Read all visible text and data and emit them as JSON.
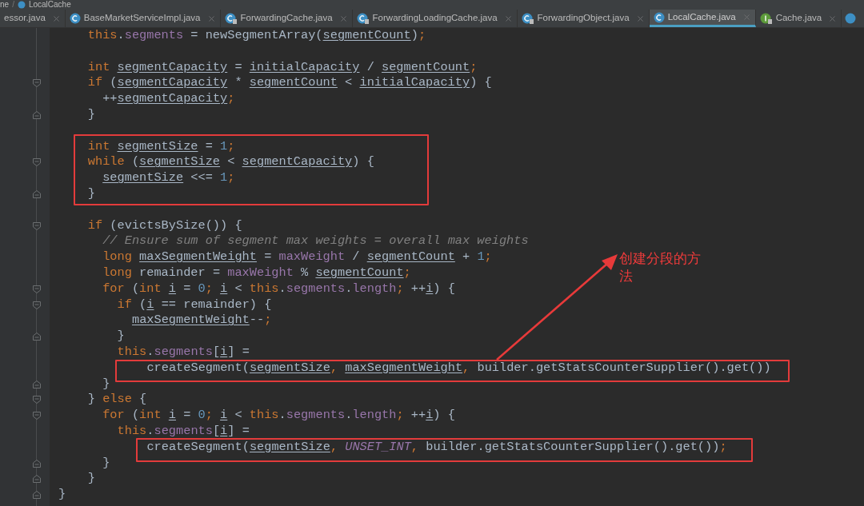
{
  "breadcrumb": [
    {
      "label": "ne",
      "kind": "plain"
    },
    {
      "separator": "/",
      "label": "LocalCache",
      "kind": "class"
    }
  ],
  "tabs": [
    {
      "label": "essor.java",
      "kind": "plain",
      "selected": false
    },
    {
      "label": "BaseMarketServiceImpl.java",
      "kind": "class",
      "selected": false
    },
    {
      "label": "ForwardingCache.java",
      "kind": "abstract",
      "selected": false
    },
    {
      "label": "ForwardingLoadingCache.java",
      "kind": "abstract",
      "selected": false
    },
    {
      "label": "ForwardingObject.java",
      "kind": "abstract",
      "selected": false
    },
    {
      "label": "LocalCache.java",
      "kind": "class",
      "selected": true
    },
    {
      "label": "Cache.java",
      "kind": "interface",
      "selected": false
    }
  ],
  "code": [
    {
      "kind": "group",
      "children": [
        {
          "kind": "line",
          "tokens": [
            {
              "kind": "kw",
              "text": "this"
            },
            {
              "kind": "p",
              "text": "."
            },
            {
              "kind": "field",
              "text": "segments"
            },
            {
              "kind": "p",
              "text": " = newSegmentArray("
            },
            {
              "kind": "var",
              "text": "segmentCount"
            },
            {
              "kind": "p",
              "text": ")"
            },
            {
              "kind": "punct",
              "text": ";"
            }
          ]
        },
        {
          "kind": "blank"
        },
        {
          "kind": "line",
          "tokens": [
            {
              "kind": "kw",
              "text": "int "
            },
            {
              "kind": "var",
              "text": "segmentCapacity"
            },
            {
              "kind": "p",
              "text": " = "
            },
            {
              "kind": "var",
              "text": "initialCapacity"
            },
            {
              "kind": "p",
              "text": " / "
            },
            {
              "kind": "var",
              "text": "segmentCount"
            },
            {
              "kind": "punct",
              "text": ";"
            }
          ]
        },
        {
          "kind": "line",
          "fold": {
            "kind": "open"
          },
          "tokens": [
            {
              "kind": "kw",
              "text": "if"
            },
            {
              "kind": "p",
              "text": " ("
            },
            {
              "kind": "var",
              "text": "segmentCapacity"
            },
            {
              "kind": "p",
              "text": " * "
            },
            {
              "kind": "var",
              "text": "segmentCount"
            },
            {
              "kind": "p",
              "text": " < "
            },
            {
              "kind": "var",
              "text": "initialCapacity"
            },
            {
              "kind": "p",
              "text": ") {"
            }
          ],
          "children": [
            {
              "kind": "line",
              "tokens": [
                {
                  "kind": "p",
                  "text": "++"
                },
                {
                  "kind": "var",
                  "text": "segmentCapacity"
                },
                {
                  "kind": "punct",
                  "text": ";"
                }
              ]
            }
          ]
        },
        {
          "kind": "line",
          "fold": {
            "kind": "close"
          },
          "tokens": [
            {
              "kind": "p",
              "text": "}"
            }
          ]
        },
        {
          "kind": "blank"
        },
        {
          "kind": "line",
          "boxed": true,
          "tokens": [
            {
              "kind": "kw",
              "text": "int "
            },
            {
              "kind": "var",
              "text": "segmentSize"
            },
            {
              "kind": "p",
              "text": " = "
            },
            {
              "kind": "num",
              "text": "1"
            },
            {
              "kind": "punct",
              "text": ";"
            }
          ]
        },
        {
          "kind": "line",
          "boxed": true,
          "fold": {
            "kind": "open"
          },
          "tokens": [
            {
              "kind": "kw",
              "text": "while"
            },
            {
              "kind": "p",
              "text": " ("
            },
            {
              "kind": "var",
              "text": "segmentSize"
            },
            {
              "kind": "p",
              "text": " < "
            },
            {
              "kind": "var",
              "text": "segmentCapacity"
            },
            {
              "kind": "p",
              "text": ") {"
            }
          ],
          "children": [
            {
              "kind": "line",
              "tokens": [
                {
                  "kind": "var",
                  "text": "segmentSize"
                },
                {
                  "kind": "p",
                  "text": " <<= "
                },
                {
                  "kind": "num",
                  "text": "1"
                },
                {
                  "kind": "punct",
                  "text": ";"
                }
              ]
            }
          ]
        },
        {
          "kind": "line",
          "boxed": true,
          "fold": {
            "kind": "close"
          },
          "tokens": [
            {
              "kind": "p",
              "text": "}"
            }
          ]
        },
        {
          "kind": "blank"
        },
        {
          "kind": "line",
          "fold": {
            "kind": "open"
          },
          "tokens": [
            {
              "kind": "kw",
              "text": "if"
            },
            {
              "kind": "p",
              "text": " (evictsBySize()) {"
            }
          ],
          "children": [
            {
              "kind": "line",
              "tokens": [
                {
                  "kind": "cmt",
                  "text": "// Ensure sum of segment max weights = overall max weights"
                }
              ]
            },
            {
              "kind": "line",
              "tokens": [
                {
                  "kind": "kw",
                  "text": "long "
                },
                {
                  "kind": "var",
                  "text": "maxSegmentWeight"
                },
                {
                  "kind": "p",
                  "text": " = "
                },
                {
                  "kind": "field",
                  "text": "maxWeight"
                },
                {
                  "kind": "p",
                  "text": " / "
                },
                {
                  "kind": "var",
                  "text": "segmentCount"
                },
                {
                  "kind": "p",
                  "text": " + "
                },
                {
                  "kind": "num",
                  "text": "1"
                },
                {
                  "kind": "punct",
                  "text": ";"
                }
              ]
            },
            {
              "kind": "line",
              "tokens": [
                {
                  "kind": "kw",
                  "text": "long"
                },
                {
                  "kind": "p",
                  "text": " remainder = "
                },
                {
                  "kind": "field",
                  "text": "maxWeight"
                },
                {
                  "kind": "p",
                  "text": " % "
                },
                {
                  "kind": "var",
                  "text": "segmentCount"
                },
                {
                  "kind": "punct",
                  "text": ";"
                }
              ]
            },
            {
              "kind": "line",
              "fold": {
                "kind": "open"
              },
              "tokens": [
                {
                  "kind": "kw",
                  "text": "for"
                },
                {
                  "kind": "p",
                  "text": " ("
                },
                {
                  "kind": "kw",
                  "text": "int "
                },
                {
                  "kind": "var",
                  "text": "i"
                },
                {
                  "kind": "p",
                  "text": " = "
                },
                {
                  "kind": "num",
                  "text": "0"
                },
                {
                  "kind": "punct",
                  "text": "; "
                },
                {
                  "kind": "var",
                  "text": "i"
                },
                {
                  "kind": "p",
                  "text": " < "
                },
                {
                  "kind": "kw",
                  "text": "this"
                },
                {
                  "kind": "p",
                  "text": "."
                },
                {
                  "kind": "field",
                  "text": "segments"
                },
                {
                  "kind": "p",
                  "text": "."
                },
                {
                  "kind": "field",
                  "text": "length"
                },
                {
                  "kind": "punct",
                  "text": ";"
                },
                {
                  "kind": "p",
                  "text": " ++"
                },
                {
                  "kind": "var",
                  "text": "i"
                },
                {
                  "kind": "p",
                  "text": ") {"
                }
              ],
              "children": [
                {
                  "kind": "line",
                  "fold": {
                    "kind": "open"
                  },
                  "tokens": [
                    {
                      "kind": "kw",
                      "text": "if"
                    },
                    {
                      "kind": "p",
                      "text": " ("
                    },
                    {
                      "kind": "var",
                      "text": "i"
                    },
                    {
                      "kind": "p",
                      "text": " == remainder) {"
                    }
                  ],
                  "children": [
                    {
                      "kind": "line",
                      "tokens": [
                        {
                          "kind": "var",
                          "text": "maxSegmentWeight"
                        },
                        {
                          "kind": "p",
                          "text": "--"
                        },
                        {
                          "kind": "punct",
                          "text": ";"
                        }
                      ]
                    }
                  ]
                },
                {
                  "kind": "line",
                  "fold": {
                    "kind": "close"
                  },
                  "tokens": [
                    {
                      "kind": "p",
                      "text": "}"
                    }
                  ]
                },
                {
                  "kind": "line",
                  "tokens": [
                    {
                      "kind": "kw",
                      "text": "this"
                    },
                    {
                      "kind": "p",
                      "text": "."
                    },
                    {
                      "kind": "field",
                      "text": "segments"
                    },
                    {
                      "kind": "p",
                      "text": "["
                    },
                    {
                      "kind": "var",
                      "text": "i"
                    },
                    {
                      "kind": "p",
                      "text": "] ="
                    }
                  ]
                },
                {
                  "kind": "group",
                  "children": [
                    {
                      "kind": "line",
                      "boxed": true,
                      "tokens": [
                        {
                          "kind": "p",
                          "text": "createSegment("
                        },
                        {
                          "kind": "var",
                          "text": "segmentSize"
                        },
                        {
                          "kind": "punct",
                          "text": ", "
                        },
                        {
                          "kind": "var",
                          "text": "maxSegmentWeight"
                        },
                        {
                          "kind": "punct",
                          "text": ","
                        },
                        {
                          "kind": "p",
                          "text": " builder.getStatsCounterSupplier().get())"
                        }
                      ]
                    }
                  ]
                }
              ]
            },
            {
              "kind": "line",
              "fold": {
                "kind": "close"
              },
              "tokens": [
                {
                  "kind": "p",
                  "text": "}"
                }
              ]
            }
          ]
        },
        {
          "kind": "line",
          "fold": {
            "kind": "open"
          },
          "tokens": [
            {
              "kind": "p",
              "text": "} "
            },
            {
              "kind": "kw",
              "text": "else"
            },
            {
              "kind": "p",
              "text": " {"
            }
          ],
          "children": [
            {
              "kind": "line",
              "fold": {
                "kind": "open"
              },
              "tokens": [
                {
                  "kind": "kw",
                  "text": "for"
                },
                {
                  "kind": "p",
                  "text": " ("
                },
                {
                  "kind": "kw",
                  "text": "int "
                },
                {
                  "kind": "var",
                  "text": "i"
                },
                {
                  "kind": "p",
                  "text": " = "
                },
                {
                  "kind": "num",
                  "text": "0"
                },
                {
                  "kind": "punct",
                  "text": "; "
                },
                {
                  "kind": "var",
                  "text": "i"
                },
                {
                  "kind": "p",
                  "text": " < "
                },
                {
                  "kind": "kw",
                  "text": "this"
                },
                {
                  "kind": "p",
                  "text": "."
                },
                {
                  "kind": "field",
                  "text": "segments"
                },
                {
                  "kind": "p",
                  "text": "."
                },
                {
                  "kind": "field",
                  "text": "length"
                },
                {
                  "kind": "punct",
                  "text": ";"
                },
                {
                  "kind": "p",
                  "text": " ++"
                },
                {
                  "kind": "var",
                  "text": "i"
                },
                {
                  "kind": "p",
                  "text": ") {"
                }
              ],
              "children": [
                {
                  "kind": "line",
                  "tokens": [
                    {
                      "kind": "kw",
                      "text": "this"
                    },
                    {
                      "kind": "p",
                      "text": "."
                    },
                    {
                      "kind": "field",
                      "text": "segments"
                    },
                    {
                      "kind": "p",
                      "text": "["
                    },
                    {
                      "kind": "var",
                      "text": "i"
                    },
                    {
                      "kind": "p",
                      "text": "] ="
                    }
                  ]
                },
                {
                  "kind": "group",
                  "children": [
                    {
                      "kind": "line",
                      "boxed": true,
                      "tokens": [
                        {
                          "kind": "p",
                          "text": "createSegment("
                        },
                        {
                          "kind": "var",
                          "text": "segmentSize"
                        },
                        {
                          "kind": "punct",
                          "text": ", "
                        },
                        {
                          "kind": "const",
                          "text": "UNSET_INT"
                        },
                        {
                          "kind": "punct",
                          "text": ","
                        },
                        {
                          "kind": "p",
                          "text": " builder.getStatsCounterSupplier().get())"
                        },
                        {
                          "kind": "punct",
                          "text": ";"
                        }
                      ]
                    }
                  ]
                }
              ]
            },
            {
              "kind": "line",
              "fold": {
                "kind": "close"
              },
              "tokens": [
                {
                  "kind": "p",
                  "text": "}"
                }
              ]
            }
          ]
        },
        {
          "kind": "line",
          "fold": {
            "kind": "close"
          },
          "tokens": [
            {
              "kind": "p",
              "text": "}"
            }
          ]
        }
      ]
    },
    {
      "kind": "line",
      "fold": {
        "kind": "close"
      },
      "tokens": [
        {
          "kind": "p",
          "text": "}"
        }
      ]
    }
  ],
  "annotation": "创建分段的方法"
}
